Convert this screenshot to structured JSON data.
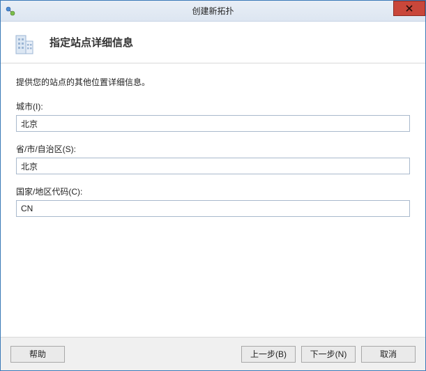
{
  "window": {
    "title": "创建新拓扑"
  },
  "header": {
    "title": "指定站点详细信息"
  },
  "content": {
    "instruction": "提供您的站点的其他位置详细信息。",
    "fields": {
      "city": {
        "label": "城市(I):",
        "value": "北京"
      },
      "state": {
        "label": "省/市/自治区(S):",
        "value": "北京"
      },
      "country": {
        "label": "国家/地区代码(C):",
        "value": "CN"
      }
    }
  },
  "footer": {
    "help": "帮助",
    "back": "上一步(B)",
    "next": "下一步(N)",
    "cancel": "取消"
  }
}
